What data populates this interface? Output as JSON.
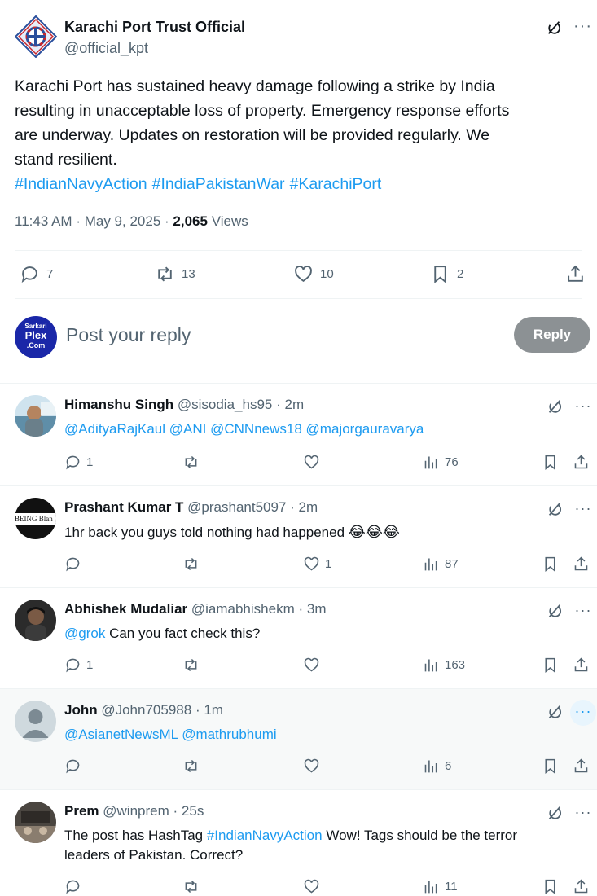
{
  "post": {
    "author_name": "Karachi Port Trust Official",
    "author_handle": "@official_kpt",
    "text_lines": [
      "Karachi Port has sustained heavy damage following a strike by India",
      "resulting in unacceptable loss of property. Emergency response efforts",
      "are underway. Updates on restoration will be provided regularly. We",
      "stand resilient."
    ],
    "hashtags": [
      "#IndianNavyAction",
      "#IndiaPakistanWar",
      "#KarachiPort"
    ],
    "time": "11:43 AM",
    "date": "May 9, 2025",
    "views_count": "2,065",
    "views_label": "Views",
    "separator": "·",
    "counts": {
      "replies": "7",
      "reposts": "13",
      "likes": "10",
      "bookmarks": "2"
    }
  },
  "reply_box": {
    "avatar_line1": "Sarkari",
    "avatar_line2": "Plex",
    "avatar_line3": ".Com",
    "placeholder": "Post your reply",
    "button_label": "Reply"
  },
  "replies": [
    {
      "name": "Himanshu Singh",
      "handle": "@sisodia_hs95",
      "time": "2m",
      "mentions": [
        "@AdityaRajKaul",
        "@ANI",
        "@CNNnews18",
        "@majorgauravarya"
      ],
      "replies": "1",
      "reposts": "",
      "likes": "",
      "views": "76"
    },
    {
      "name": "Prashant Kumar T",
      "handle": "@prashant5097",
      "time": "2m",
      "avatar_text": "BEING Blan",
      "text": "1hr back you guys told nothing had happened",
      "emoji": "😂😂😂",
      "replies": "",
      "reposts": "",
      "likes": "1",
      "views": "87"
    },
    {
      "name": "Abhishek Mudaliar",
      "handle": "@iamabhishekm",
      "time": "3m",
      "mention": "@grok",
      "text": "Can you fact check this?",
      "replies": "1",
      "reposts": "",
      "likes": "",
      "views": "163"
    },
    {
      "name": "John",
      "handle": "@John705988",
      "time": "1m",
      "mentions": [
        "@AsianetNewsML",
        "@mathrubhumi"
      ],
      "replies": "",
      "reposts": "",
      "likes": "",
      "views": "6"
    },
    {
      "name": "Prem",
      "handle": "@winprem",
      "time": "25s",
      "text_a": "The post has HashTag",
      "hashtag": "#IndianNavyAction",
      "text_b": "Wow! Tags should be the terror",
      "text_c": "leaders of Pakistan. Correct?",
      "replies": "",
      "reposts": "",
      "likes": "",
      "views": "11"
    }
  ],
  "colors": {
    "link": "#1d9bf0",
    "muted": "#536471",
    "reply_button": "#8c9194"
  }
}
